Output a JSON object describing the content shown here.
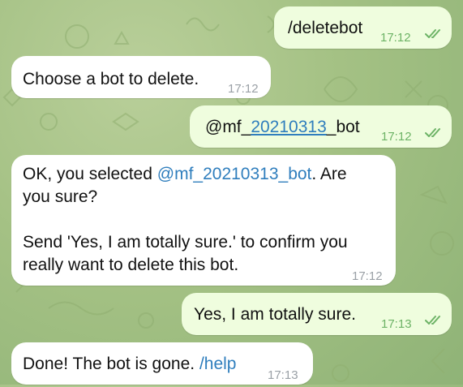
{
  "colors": {
    "incoming_bubble": "#ffffff",
    "outgoing_bubble": "#effdde",
    "link": "#2f7ebd",
    "outgoing_time": "#6db366",
    "incoming_time": "#9aa0a6",
    "wallpaper": "#a4c184"
  },
  "messages": [
    {
      "direction": "outgoing",
      "text": "/deletebot",
      "time": "17:12",
      "status_icon": "double-check-icon"
    },
    {
      "direction": "incoming",
      "text": "Choose a bot to delete.",
      "time": "17:12"
    },
    {
      "direction": "outgoing",
      "text_prefix": "@mf_",
      "text_link": "20210313",
      "text_suffix": "_bot",
      "time": "17:12",
      "status_icon": "double-check-icon"
    },
    {
      "direction": "incoming",
      "text_line1_a": "OK, you selected ",
      "text_line1_mention": "@mf_20210313_bot",
      "text_line1_b": ". Are",
      "text_line2": "you sure?",
      "text_line3": "Send 'Yes, I am totally sure.' to confirm you",
      "text_line4": "really want to delete this bot.",
      "time": "17:12"
    },
    {
      "direction": "outgoing",
      "text": "Yes, I am totally sure.",
      "time": "17:13",
      "status_icon": "double-check-icon"
    },
    {
      "direction": "incoming",
      "text_a": "Done! The bot is gone. ",
      "text_cmd": "/help",
      "time": "17:13"
    }
  ]
}
